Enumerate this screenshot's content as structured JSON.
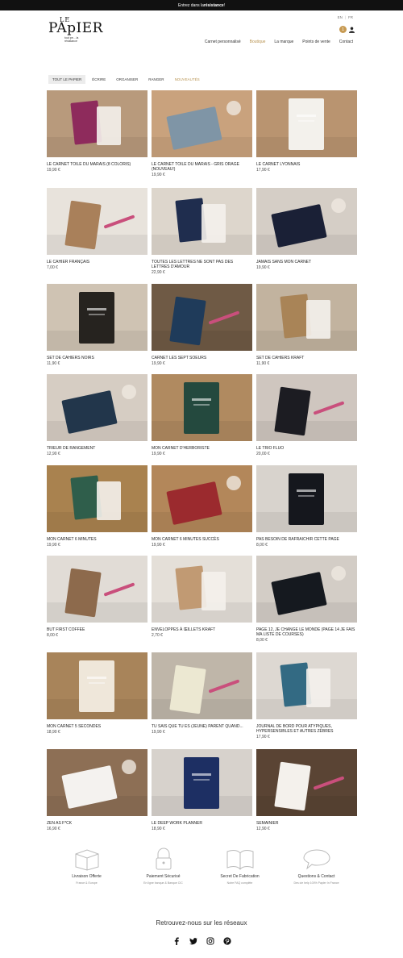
{
  "topbar": {
    "prefix": "Entrez dans la ",
    "highlight": "résistance",
    "suffix": " !"
  },
  "logo": {
    "le": "LE",
    "papier": "PApIER",
    "tagline": "tout pe... la résistance"
  },
  "lang": {
    "fr": "EN",
    "en": "FR"
  },
  "cart": {
    "count": "1"
  },
  "nav": [
    "Carnet personnalisé",
    "Boutique",
    "La marque",
    "Points de vente",
    "Contact"
  ],
  "filters": [
    "TOUT LE PAPIER",
    "ÉCRIRE",
    "ORGANISER",
    "RANGER",
    "NOUVEAUTÉS"
  ],
  "products": [
    {
      "title": "LE CARNET TOILE DU MARAIS (8 COLORIS)",
      "price": "19,90 €",
      "bg": "#b89a7c",
      "accent": "#8e2b5c"
    },
    {
      "title": "LE CARNET TOILE DU MARAIS - GRIS ORAGE (NOUVEAU!)",
      "price": "19,90 €",
      "bg": "#c9a27d",
      "accent": "#7f95a6"
    },
    {
      "title": "LE CARNET LYONNAIS",
      "price": "17,90 €",
      "bg": "#b99470",
      "accent": "#f3f1ec"
    },
    {
      "title": "LE CAHIER FRANÇAIS",
      "price": "7,00 €",
      "bg": "#e8e3dc",
      "accent": "#a9805a"
    },
    {
      "title": "TOUTES LES LETTRES NE SONT PAS DES LETTRES D'AMOUR",
      "price": "22,90 €",
      "bg": "#ddd6cc",
      "accent": "#1f2d4e"
    },
    {
      "title": "JAMAIS SANS MON CARNET",
      "price": "19,90 €",
      "bg": "#d5cec6",
      "accent": "#1a2036"
    },
    {
      "title": "SET DE CAHIERS NOIRS",
      "price": "11,90 €",
      "bg": "#cfc3b3",
      "accent": "#26231f"
    },
    {
      "title": "CARNET LES SEPT SOEURS",
      "price": "19,90 €",
      "bg": "#6f5a45",
      "accent": "#1f3b5a"
    },
    {
      "title": "SET DE CAHIERS KRAFT",
      "price": "11,90 €",
      "bg": "#c2b39f",
      "accent": "#a98457"
    },
    {
      "title": "TRIEUR DE RANGEMENT",
      "price": "12,90 €",
      "bg": "#d6cdc3",
      "accent": "#22364b"
    },
    {
      "title": "MON CARNET D'HERBORISTE",
      "price": "19,90 €",
      "bg": "#b08a60",
      "accent": "#24493e"
    },
    {
      "title": "LE TRIO FLUO",
      "price": "20,00 €",
      "bg": "#cfc6bf",
      "accent": "#1c1c22"
    },
    {
      "title": "MON CARNET 6 MINUTES",
      "price": "19,90 €",
      "bg": "#a9824f",
      "accent": "#2f5e4b"
    },
    {
      "title": "MON CARNET 6 MINUTES SUCCÈS",
      "price": "19,90 €",
      "bg": "#b3875a",
      "accent": "#9b2a2e"
    },
    {
      "title": "PAS BESOIN DE RAFRAICHIR CETTE PAGE",
      "price": "8,00 €",
      "bg": "#d8d3cd",
      "accent": "#15171d"
    },
    {
      "title": "BUT FIRST COFFEE",
      "price": "8,00 €",
      "bg": "#e1dcd6",
      "accent": "#8d6a4c"
    },
    {
      "title": "ENVELOPPES À ŒILLETS KRAFT",
      "price": "2,70 €",
      "bg": "#e4dfd8",
      "accent": "#c19a73"
    },
    {
      "title": "PAGE 12, JE CHANGE LE MONDE (PAGE 14 JE FAIS MA LISTE DE COURSES)",
      "price": "8,00 €",
      "bg": "#d3cdc6",
      "accent": "#15191f"
    },
    {
      "title": "MON CARNET 5 SECONDES",
      "price": "18,90 €",
      "bg": "#a8845a",
      "accent": "#efe7da"
    },
    {
      "title": "TU SAIS QUE TU ES (JEUNE) PARENT QUAND...",
      "price": "19,90 €",
      "bg": "#bfb6a9",
      "accent": "#ece8d2"
    },
    {
      "title": "JOURNAL DE BORD POUR ATYPIQUES, HYPERSENSIBLES ET AUTRES ZÈBRES",
      "price": "17,90 €",
      "bg": "#ddd8d2",
      "accent": "#336a83"
    },
    {
      "title": "ZEN AS F*CK",
      "price": "16,90 €",
      "bg": "#8d6f55",
      "accent": "#f4f2ef"
    },
    {
      "title": "LE DEEP WORK PLANNER",
      "price": "18,90 €",
      "bg": "#d7d2cc",
      "accent": "#1d2f63"
    },
    {
      "title": "SEMAINIER",
      "price": "12,90 €",
      "bg": "#5a4434",
      "accent": "#f4f1ec"
    }
  ],
  "services": [
    {
      "title": "Livraison Offerte",
      "sub": "France & Europe",
      "icon": "box-icon"
    },
    {
      "title": "Paiement Sécurisé",
      "sub": "En ligne banque & Banque CIC",
      "icon": "padlock-icon"
    },
    {
      "title": "Secret De Fabrication",
      "sub": "Notre FAQ complète",
      "icon": "book-icon"
    },
    {
      "title": "Questions & Contact",
      "sub": "Des cie help 100% Papier In France",
      "icon": "chat-bubble-icon"
    }
  ],
  "social": {
    "title": "Retrouvez-nous sur les réseaux",
    "networks": [
      "facebook-icon",
      "twitter-icon",
      "instagram-icon",
      "pinterest-icon"
    ]
  }
}
